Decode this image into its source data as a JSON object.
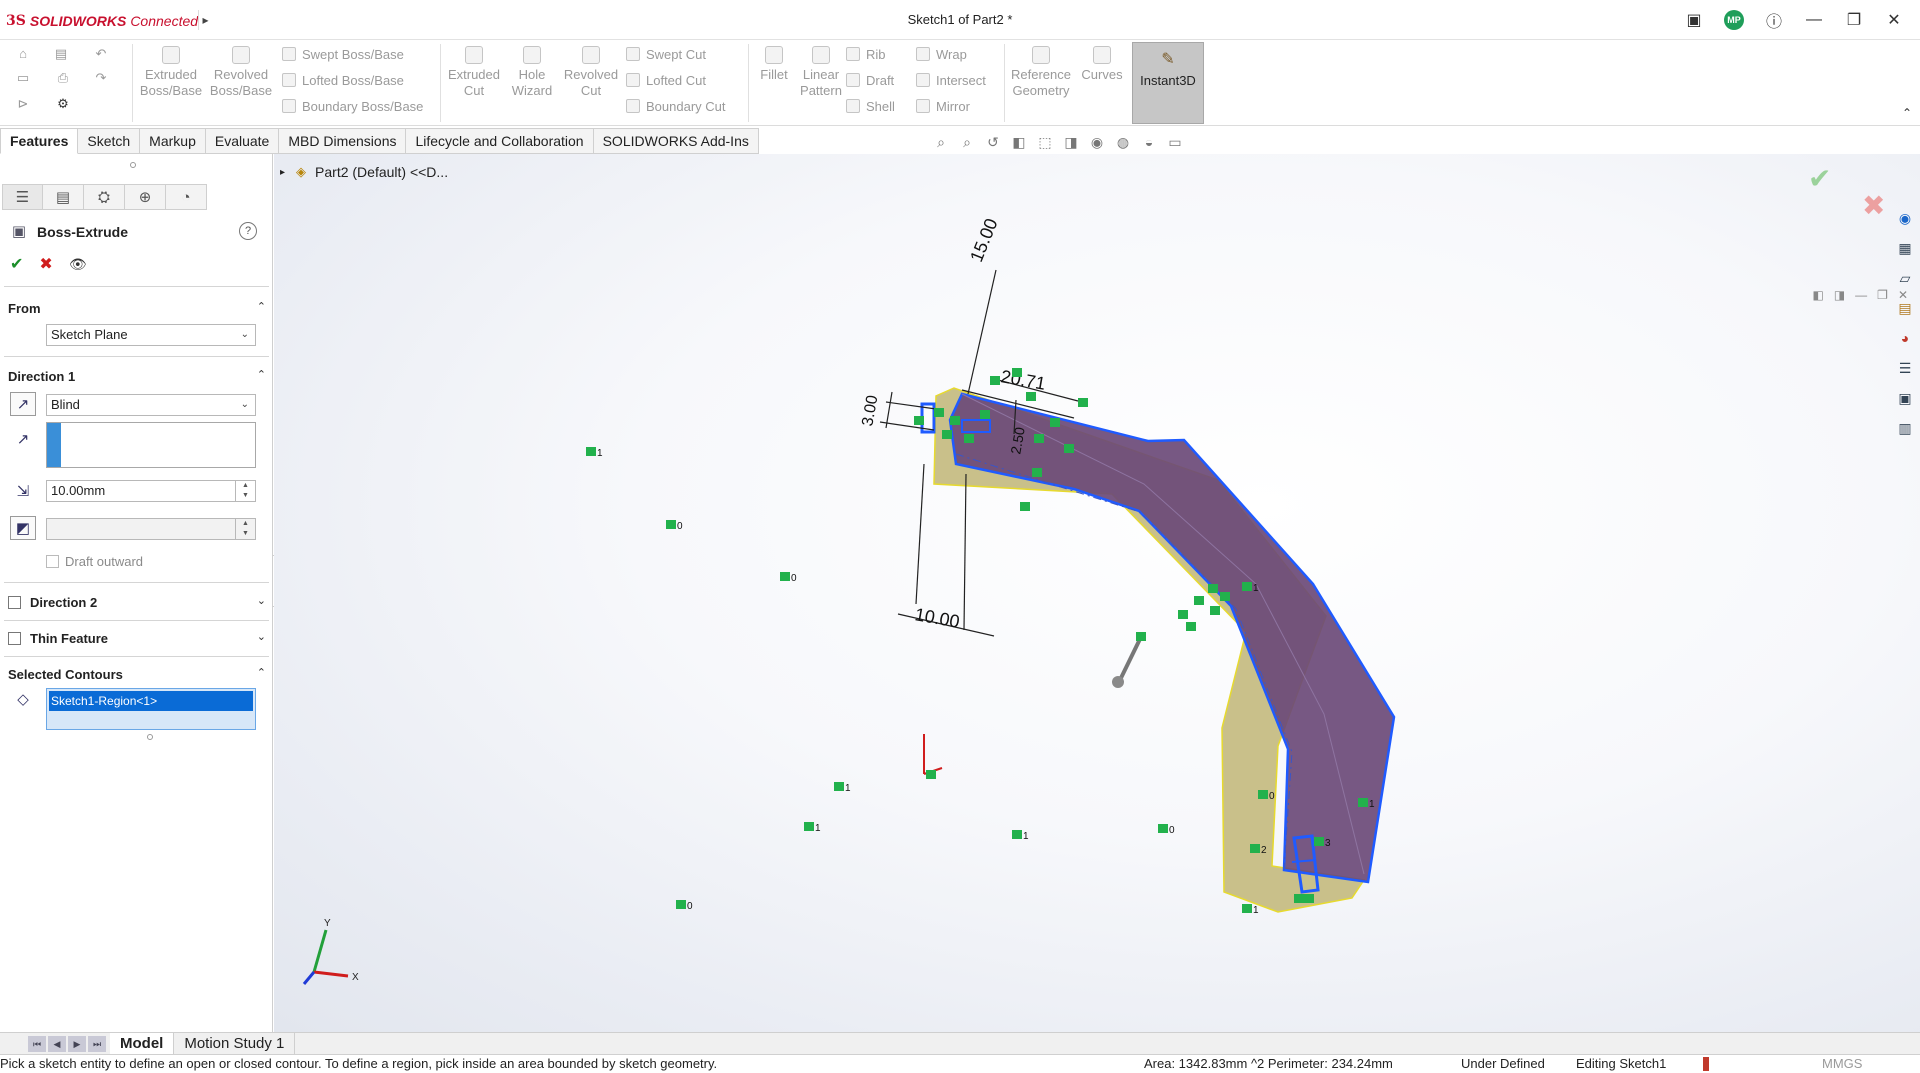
{
  "titlebar": {
    "brand": "SOLIDWORKS",
    "brand_suffix": "Connected",
    "document_title": "Sketch1 of Part2 *",
    "avatar_initials": "MP",
    "icons": [
      "terminal-icon",
      "help-icon",
      "minimize-icon",
      "restore-icon",
      "close-icon"
    ]
  },
  "commands": {
    "extruded_boss": "Extruded Boss/Base",
    "revolved_boss": "Revolved Boss/Base",
    "swept_boss": "Swept Boss/Base",
    "lofted_boss": "Lofted Boss/Base",
    "boundary_boss": "Boundary Boss/Base",
    "extruded_cut": "Extruded Cut",
    "hole_wizard": "Hole Wizard",
    "revolved_cut": "Revolved Cut",
    "swept_cut": "Swept Cut",
    "lofted_cut": "Lofted Cut",
    "boundary_cut": "Boundary Cut",
    "fillet": "Fillet",
    "linear_pattern": "Linear Pattern",
    "rib": "Rib",
    "draft": "Draft",
    "shell": "Shell",
    "wrap": "Wrap",
    "intersect": "Intersect",
    "mirror": "Mirror",
    "reference_geometry": "Reference Geometry",
    "curves": "Curves",
    "instant3d": "Instant3D"
  },
  "tabs": [
    "Features",
    "Sketch",
    "Markup",
    "Evaluate",
    "MBD Dimensions",
    "Lifecycle and Collaboration",
    "SOLIDWORKS Add-Ins"
  ],
  "property_manager": {
    "title": "Boss-Extrude",
    "help": "?",
    "from": {
      "label": "From",
      "value": "Sketch Plane"
    },
    "direction1": {
      "label": "Direction 1",
      "end_condition": "Blind",
      "depth": "10.00mm",
      "draft_label": "Draft outward"
    },
    "direction2": {
      "label": "Direction 2"
    },
    "thin_feature": {
      "label": "Thin Feature"
    },
    "selected_contours": {
      "label": "Selected Contours",
      "item": "Sketch1-Region<1>"
    }
  },
  "viewport": {
    "tree_flyout": "Part2 (Default) <<D...",
    "dimensions": [
      "15.00",
      "20.71",
      "3.00",
      "2.50",
      "10.00"
    ],
    "relation_tags": [
      {
        "label": "1"
      },
      {
        "label": "0"
      },
      {
        "label": "0"
      },
      {
        "label": "1"
      },
      {
        "label": "1"
      },
      {
        "label": "1"
      },
      {
        "label": "0"
      },
      {
        "label": "0"
      },
      {
        "label": "1"
      },
      {
        "label": "1"
      },
      {
        "label": "0"
      },
      {
        "label": "3"
      },
      {
        "label": "2"
      },
      {
        "label": "1"
      }
    ],
    "triad": {
      "x": "X",
      "y": "Y"
    },
    "colors": {
      "face_purple": "#6b4a78",
      "side_yellow": "#c8bf7a",
      "sketch_blue": "#1f5bff",
      "relation_green": "#22b14c"
    }
  },
  "bottom_tabs": [
    "Model",
    "Motion Study 1"
  ],
  "status": {
    "hint": "Pick a sketch entity to define an open or closed contour. To define a region, pick inside an area bounded by sketch geometry.",
    "area": "Area: 1342.83mm ^2 Perimeter: 234.24mm",
    "definition": "Under Defined",
    "editing": "Editing Sketch1",
    "units": "MMGS"
  }
}
